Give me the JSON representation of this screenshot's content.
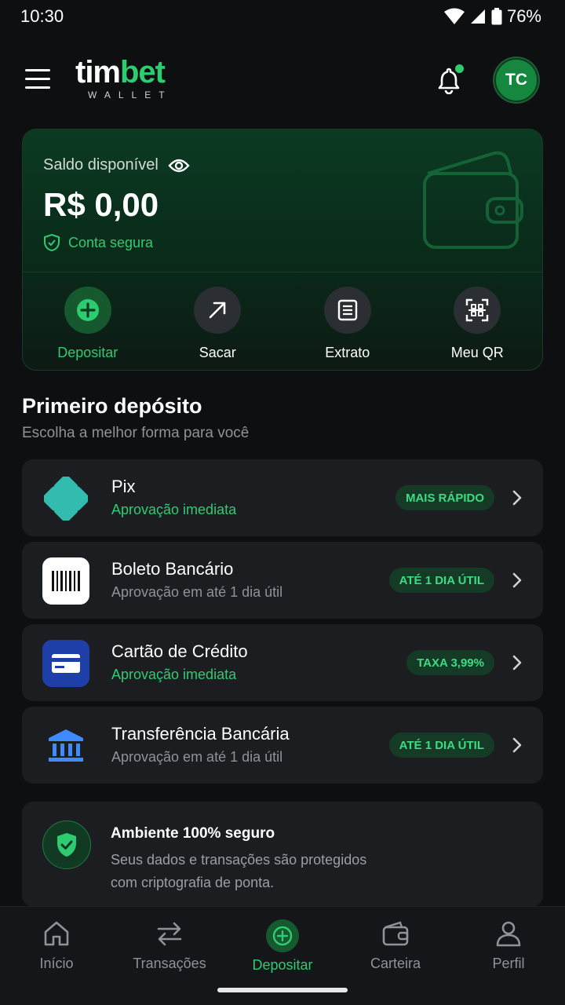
{
  "status": {
    "time": "10:30",
    "battery": "76%"
  },
  "header": {
    "logo_a": "tim",
    "logo_b": "bet",
    "logo_sub": "WALLET",
    "avatar_initials": "TC"
  },
  "balance": {
    "label": "Saldo disponível",
    "value": "R$ 0,00",
    "secure_text": "Conta segura",
    "actions": [
      {
        "label": "Depositar",
        "icon": "plus-circle-icon"
      },
      {
        "label": "Sacar",
        "icon": "arrow-up-right-icon"
      },
      {
        "label": "Extrato",
        "icon": "document-icon"
      },
      {
        "label": "Meu QR",
        "icon": "qr-scan-icon"
      }
    ]
  },
  "section": {
    "title": "Primeiro depósito",
    "subtitle": "Escolha a melhor forma para você"
  },
  "options": [
    {
      "name": "Pix",
      "desc": "Aprovação imediata",
      "badge": "MAIS RÁPIDO",
      "icon": "pix-icon"
    },
    {
      "name": "Boleto Bancário",
      "desc": "Aprovação em até 1 dia útil",
      "badge": "ATÉ 1 DIA ÚTIL",
      "icon": "barcode-icon"
    },
    {
      "name": "Cartão de Crédito",
      "desc": "Aprovação imediata",
      "badge": "TAXA 3,99%",
      "icon": "credit-card-icon"
    },
    {
      "name": "Transferência Bancária",
      "desc": "Aprovação em até 1 dia útil",
      "badge": "ATÉ 1 DIA ÚTIL",
      "icon": "bank-icon"
    }
  ],
  "safe": {
    "title": "Ambiente 100% seguro",
    "text": "Seus dados e transações são protegidos com criptografia de ponta."
  },
  "nav": [
    {
      "label": "Início",
      "icon": "home-icon"
    },
    {
      "label": "Transações",
      "icon": "swap-icon"
    },
    {
      "label": "Depositar",
      "icon": "plus-circle-icon",
      "active": true
    },
    {
      "label": "Carteira",
      "icon": "wallet-icon"
    },
    {
      "label": "Perfil",
      "icon": "user-icon"
    }
  ],
  "colors": {
    "accent": "#2ecc71",
    "background": "#0e0f11",
    "card": "#1b1d21"
  }
}
